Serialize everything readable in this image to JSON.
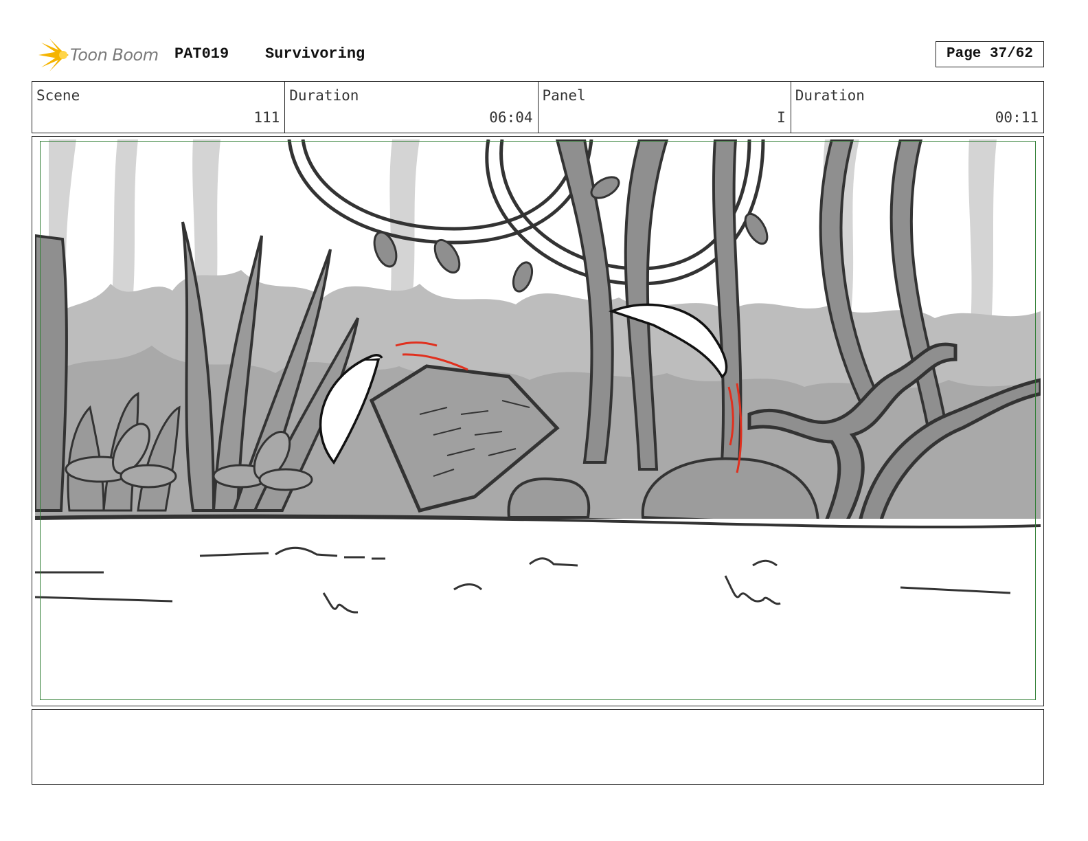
{
  "header": {
    "logo_text": "Toon Boom",
    "production_code": "PAT019",
    "production_title": "Survivoring",
    "page_label": "Page 37/62"
  },
  "info": {
    "scene_label": "Scene",
    "scene_value": "111",
    "scene_duration_label": "Duration",
    "scene_duration_value": "06:04",
    "panel_label": "Panel",
    "panel_value": "I",
    "panel_duration_label": "Duration",
    "panel_duration_value": "00:11"
  },
  "colors": {
    "logo_accent": "#f5b400",
    "safe_frame": "#2e7d32",
    "motion_lines": "#e0301e"
  },
  "notes": {
    "text": ""
  }
}
